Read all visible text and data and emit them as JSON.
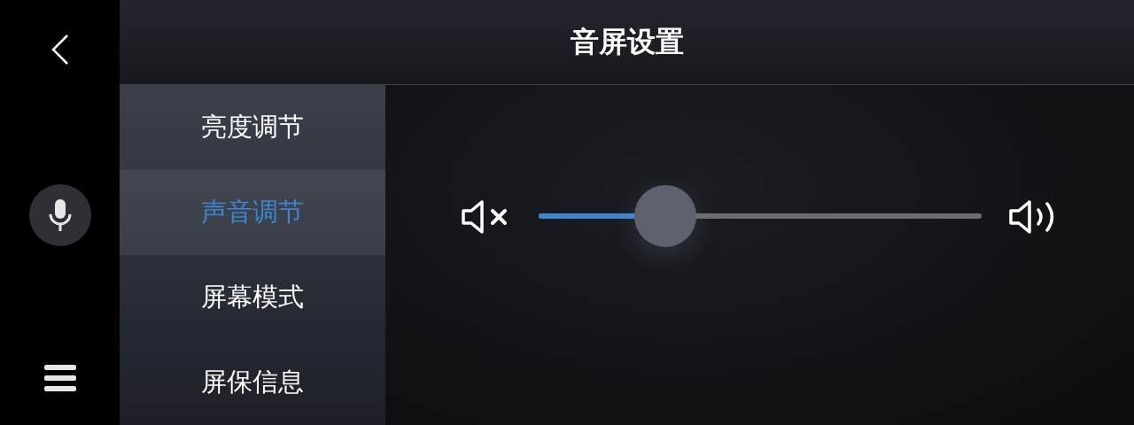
{
  "header": {
    "title": "音屏设置"
  },
  "menu": [
    {
      "label": "亮度调节",
      "selected": false
    },
    {
      "label": "声音调节",
      "selected": true
    },
    {
      "label": "屏幕模式",
      "selected": false
    },
    {
      "label": "屏保信息",
      "selected": false
    }
  ],
  "volume": {
    "level": 0.286
  }
}
